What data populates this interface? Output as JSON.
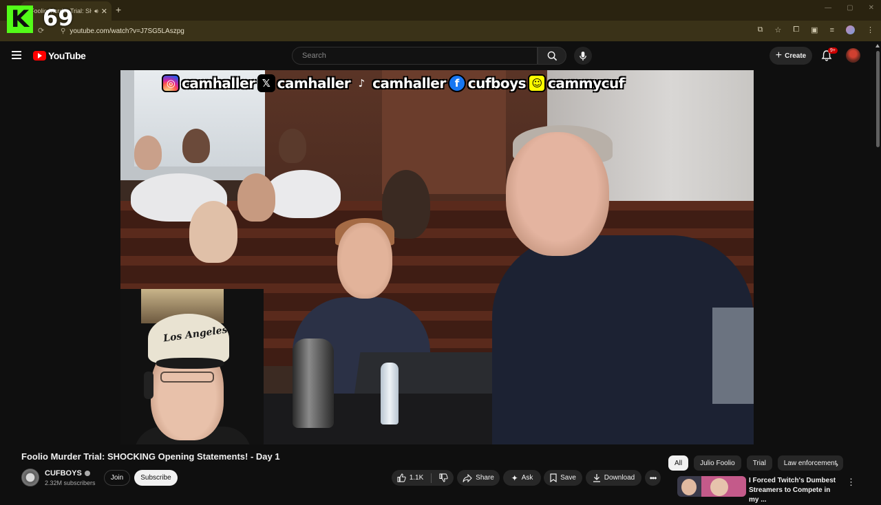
{
  "browser": {
    "tab_title": "Foolio Murder Trial: SH",
    "url": "youtube.com/watch?v=J7SG5LAszpg",
    "kick_logo_letter": "K",
    "kick_viewers": "69"
  },
  "header": {
    "logo_text": "YouTube",
    "search_placeholder": "Search",
    "create_label": "Create",
    "notif_count": "9+"
  },
  "overlay": {
    "socials": [
      {
        "icon": "instagram-icon",
        "handle": "camhaller"
      },
      {
        "icon": "x-icon",
        "handle": "camhaller"
      },
      {
        "icon": "tiktok-icon",
        "handle": "camhaller"
      },
      {
        "icon": "facebook-icon",
        "handle": "cufboys"
      },
      {
        "icon": "snapchat-icon",
        "handle": "cammycuf"
      }
    ],
    "cap_text": "Los Angeles"
  },
  "video": {
    "title": "Foolio Murder Trial: SHOCKING Opening Statements! - Day 1",
    "channel": "CUFBOYS",
    "subscribers": "2.32M subscribers",
    "join_label": "Join",
    "subscribe_label": "Subscribe",
    "likes": "1.1K",
    "share_label": "Share",
    "ask_label": "Ask",
    "save_label": "Save",
    "download_label": "Download"
  },
  "chips": [
    "All",
    "Julio Foolio",
    "Trial",
    "Law enforcement"
  ],
  "recommended": {
    "title": "I Forced Twitch's Dumbest Streamers to Compete in my ..."
  },
  "colors": {
    "yt_red": "#ff0000",
    "kick_green": "#53fc18",
    "chrome_bg": "#3a3218"
  }
}
